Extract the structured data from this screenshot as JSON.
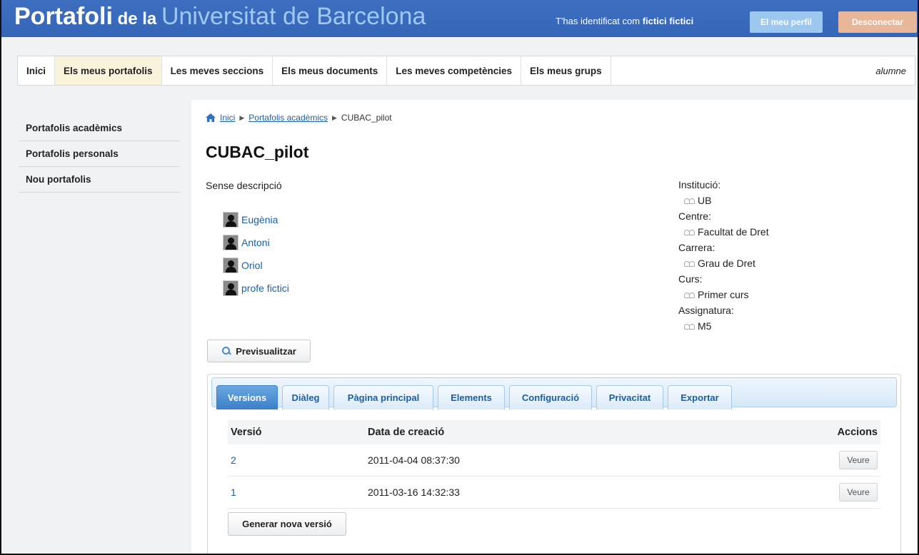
{
  "header": {
    "brand_part1": "Portafoli",
    "brand_part2": " de la ",
    "brand_part3": "Universitat de Barcelona",
    "logged_in_prefix": "T'has identificat com ",
    "logged_in_user": "fictici fictici",
    "profile_button": "El meu perfil",
    "logout_button": "Desconectar"
  },
  "topnav": {
    "items": [
      {
        "label": "Inici"
      },
      {
        "label": "Els meus portafolis"
      },
      {
        "label": "Les meves seccions"
      },
      {
        "label": "Els meus documents"
      },
      {
        "label": "Les meves competències"
      },
      {
        "label": "Els meus grups"
      }
    ],
    "role": "alumne"
  },
  "sidebar": {
    "items": [
      {
        "label": "Portafolis acadèmics"
      },
      {
        "label": "Portafolis personals"
      },
      {
        "label": "Nou portafolis"
      }
    ]
  },
  "breadcrumb": {
    "home": "Inici",
    "section": "Portafolis acadèmics",
    "current": "CUBAC_pilot"
  },
  "portfolio": {
    "title": "CUBAC_pilot",
    "description": "Sense descripció",
    "members": [
      "Eugènia",
      "Antoni",
      "Oriol",
      "profe fictici"
    ],
    "properties": [
      {
        "label": "Institució:",
        "value": "UB"
      },
      {
        "label": "Centre:",
        "value": "Facultat de Dret"
      },
      {
        "label": "Carrera:",
        "value": "Grau de Dret"
      },
      {
        "label": "Curs:",
        "value": "Primer curs"
      },
      {
        "label": "Assignatura:",
        "value": "M5"
      }
    ],
    "preview_button": "Previsualitzar"
  },
  "tabs": [
    {
      "label": "Versions"
    },
    {
      "label": "Diàleg"
    },
    {
      "label": "Pàgina principal"
    },
    {
      "label": "Elements"
    },
    {
      "label": "Configuració"
    },
    {
      "label": "Privacitat"
    },
    {
      "label": "Exportar"
    }
  ],
  "versions_table": {
    "headers": {
      "version": "Versió",
      "created": "Data de creació",
      "actions": "Accions"
    },
    "rows": [
      {
        "version": "2",
        "created": "2011-04-04 08:37:30",
        "action": "Veure"
      },
      {
        "version": "1",
        "created": "2011-03-16 14:32:33",
        "action": "Veure"
      }
    ],
    "new_version_button": "Generar nova versió"
  },
  "colors": {
    "header_bg": "#3566b8",
    "brand_accent": "#9fc8f2",
    "link": "#1a5fa8",
    "profile_button": "#9cc7ef",
    "logout_button": "#e8b79a",
    "active_tab": "#3b7fc8"
  }
}
